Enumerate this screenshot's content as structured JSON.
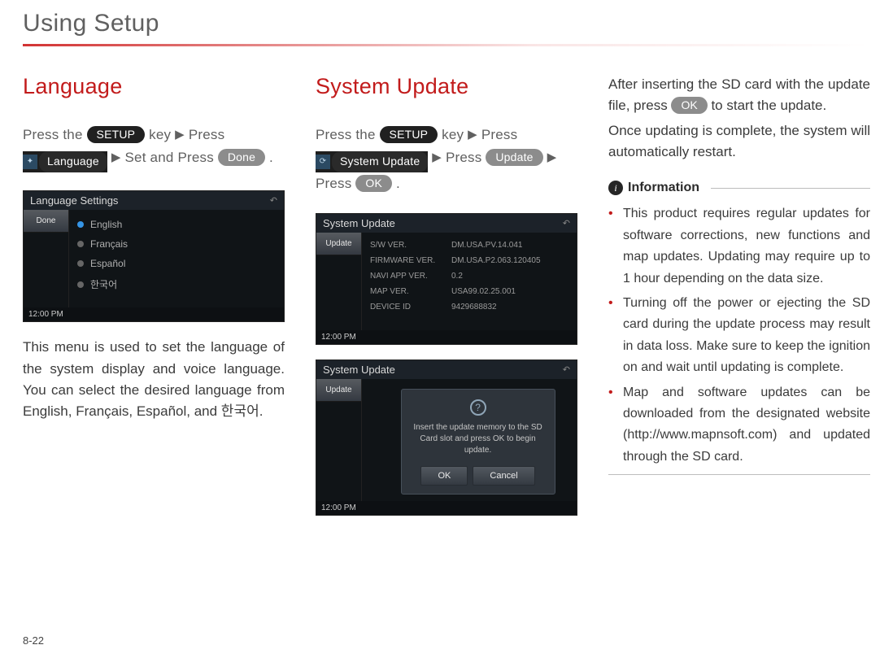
{
  "page": {
    "title": "Using Setup",
    "number": "8-22"
  },
  "arrow": "▶",
  "col1": {
    "heading": "Language",
    "step_parts": {
      "p1": "Press the ",
      "setup": "SETUP",
      "p2": " key ",
      "p3": "Press",
      "lang_btn": "Language",
      "p5": " Set and Press ",
      "done": "Done",
      "p6": " ."
    },
    "screenshot": {
      "title": "Language Settings",
      "side_btn": "Done",
      "langs": [
        "English",
        "Français",
        "Español",
        "한국어"
      ],
      "time": "12:00 PM"
    },
    "body": "This menu is used to set the language of the system display and voice language. You can select the desired language from English, Français, Español, and 한국어."
  },
  "col2": {
    "heading": "System Update",
    "step_parts": {
      "p1": "Press the ",
      "setup": "SETUP",
      "p2": " key ",
      "p3": " Press",
      "sys_btn": "System Update",
      "p5": " Press  ",
      "update": "Update",
      "p7": "Press ",
      "ok": "OK",
      "p8": " ."
    },
    "screenshot1": {
      "title": "System Update",
      "side_btn": "Update",
      "rows": [
        {
          "k": "S/W VER.",
          "v": "DM.USA.PV.14.041"
        },
        {
          "k": "FIRMWARE VER.",
          "v": "DM.USA.P2.063.120405"
        },
        {
          "k": "NAVI APP VER.",
          "v": "0.2"
        },
        {
          "k": "MAP VER.",
          "v": "USA99.02.25.001"
        },
        {
          "k": "DEVICE ID",
          "v": "9429688832"
        }
      ],
      "time": "12:00 PM"
    },
    "screenshot2": {
      "title": "System Update",
      "side_btn": "Update",
      "dialog_msg": "Insert the update memory to the SD Card slot and press OK to begin update.",
      "ok": "OK",
      "cancel": "Cancel",
      "time": "12:00 PM"
    }
  },
  "col3": {
    "intro_parts": {
      "p1": "After inserting the SD card with the update file, press ",
      "ok": "OK",
      "p2": " to start the update.",
      "p3": "Once updating is complete, the system will automatically restart."
    },
    "info_label": "Information",
    "bullets": [
      "This product requires regular updates for software corrections, new functions and map updates. Updating may require up to 1 hour depending on the data size.",
      "Turning off the power or ejecting the SD card during the update process may result in data loss. Make sure to keep the ignition on and wait until updating is complete.",
      "Map and software updates can be downloaded from the designated website (http://www.mapnsoft.com) and updated through the SD card."
    ]
  }
}
